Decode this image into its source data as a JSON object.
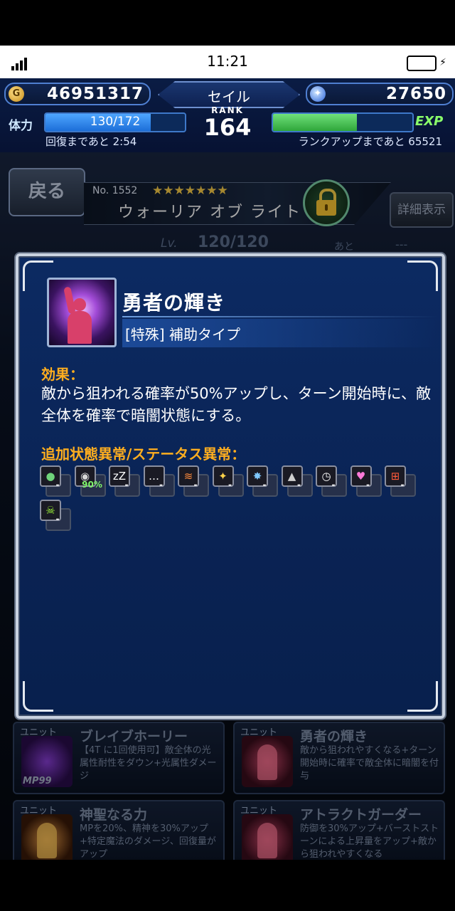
{
  "status_bar": {
    "time": "11:21"
  },
  "header": {
    "gil": "46951317",
    "player_name": "セイル",
    "rank_label": "RANK",
    "rank_value": "164",
    "lapis": "27650",
    "stamina_label": "体力",
    "stamina_value": "130/172",
    "stamina_fraction": 0.756,
    "recover_text": "回復まであと 2:54",
    "exp_label": "EXP",
    "exp_fraction": 0.6,
    "rankup_text": "ランクアップまであと 65521",
    "coin_glyph": "G",
    "gem_glyph": "✦"
  },
  "unit": {
    "back_label": "戻る",
    "number": "No. 1552",
    "stars": "★★★★★★★",
    "name": "ウォーリア オブ ライト",
    "detail_label": "詳細表示",
    "lv_label": "Lv.",
    "lv_value": "120/120",
    "lv_after": "あと",
    "lv_dash": "---"
  },
  "dialog": {
    "ability_name": "勇者の輝き",
    "ability_type": "[特殊] 補助タイプ",
    "effect_label": "効果：",
    "effect_text": "敵から狙われる確率が50%アップし、ターン開始時に、敵全体を確率で暗闇状態にする。",
    "status_label": "追加状態異常/ステータス異常：",
    "statuses": [
      {
        "icon": "poison-icon",
        "glyph": "●",
        "color": "#6fd37a",
        "value": "-"
      },
      {
        "icon": "blind-icon",
        "glyph": "◉",
        "color": "#d6d6d6",
        "value": "90%",
        "highlight": true
      },
      {
        "icon": "sleep-icon",
        "glyph": "zZ",
        "color": "#ffffff",
        "value": "-"
      },
      {
        "icon": "silence-icon",
        "glyph": "…",
        "color": "#ffffff",
        "value": "-"
      },
      {
        "icon": "paralyze-icon",
        "glyph": "≋",
        "color": "#ff8a3a",
        "value": "-"
      },
      {
        "icon": "confuse-icon",
        "glyph": "✦",
        "color": "#ffd34a",
        "value": "-"
      },
      {
        "icon": "disease-icon",
        "glyph": "✸",
        "color": "#7fc8ff",
        "value": "-"
      },
      {
        "icon": "petrify-icon",
        "glyph": "▲",
        "color": "#cfcfcf",
        "value": "-"
      },
      {
        "icon": "stop-icon",
        "glyph": "◷",
        "color": "#ffffff",
        "value": "-"
      },
      {
        "icon": "charm-icon",
        "glyph": "♥",
        "color": "#ff7ad8",
        "value": "-"
      },
      {
        "icon": "break-icon",
        "glyph": "⊞",
        "color": "#ff5a3a",
        "value": "-"
      },
      {
        "icon": "death-icon",
        "glyph": "☠",
        "color": "#a3ff3a",
        "value": "-"
      }
    ]
  },
  "cards": [
    {
      "tag": "ユニット",
      "title": "ブレイブホーリー",
      "desc": "【4T に1回使用可】敵全体の光属性耐性をダウン+光属性ダメージ",
      "mp": "MP99"
    },
    {
      "tag": "ユニット",
      "title": "勇者の輝き",
      "desc": "敵から狙われやすくなる+ターン開始時に確率で敵全体に暗闇を付与",
      "mp": ""
    },
    {
      "tag": "ユニット",
      "title": "神聖なる力",
      "desc": "MPを20%、精神を30%アップ+特定魔法のダメージ、回復量がアップ",
      "mp": ""
    },
    {
      "tag": "ユニット",
      "title": "アトラクトガーダー",
      "desc": "防御を30%アップ+バーストストーンによる上昇量をアップ+敵から狙われやすくなる",
      "mp": ""
    }
  ]
}
